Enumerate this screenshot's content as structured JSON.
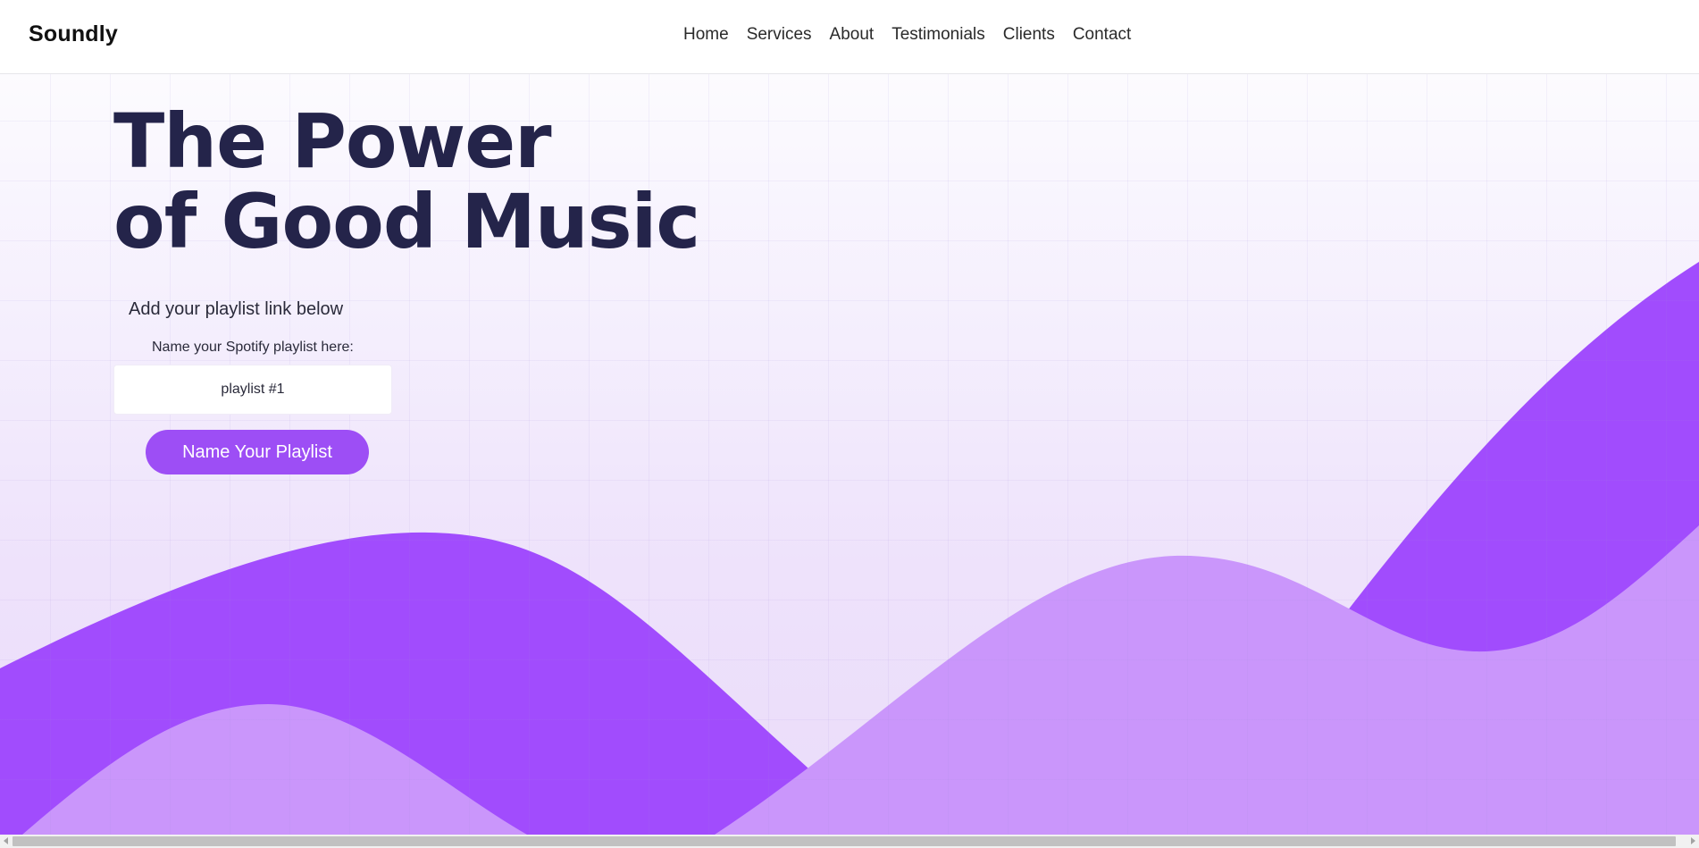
{
  "header": {
    "logo": "Soundly",
    "nav": [
      "Home",
      "Services",
      "About",
      "Testimonials",
      "Clients",
      "Contact"
    ]
  },
  "hero": {
    "headline_line1": "The Power",
    "headline_line2": "of Good Music",
    "subtitle": "Add your playlist link below",
    "field_label": "Name your Spotify playlist here:",
    "input_value": "playlist #1",
    "button_label": "Name Your Playlist"
  },
  "colors": {
    "accent": "#9d4ef5",
    "wave_dark": "#a14cfd",
    "wave_light": "#ca96fb",
    "heading": "#24244a"
  }
}
